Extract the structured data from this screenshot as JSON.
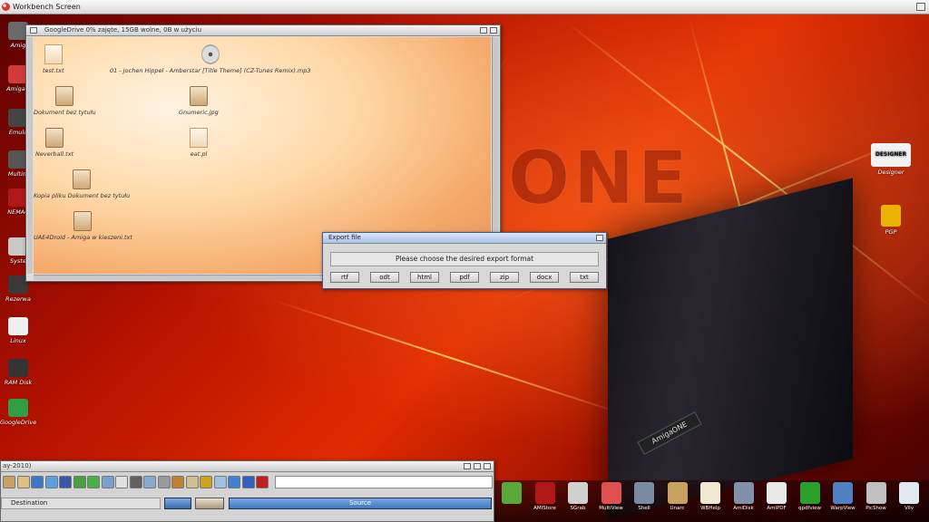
{
  "screen": {
    "title": "Workbench Screen"
  },
  "wallpaper": {
    "logo_text": "ONE",
    "tower_badge": "AmigaONE"
  },
  "desktop_left": [
    {
      "label": "Amig",
      "color": "#6a6a6a"
    },
    {
      "label": "AmigaO",
      "color": "#d33b3b"
    },
    {
      "label": "Emula",
      "color": "#444444"
    },
    {
      "label": "Multim",
      "color": "#555555"
    },
    {
      "label": "NEMAC",
      "color": "#b01818"
    },
    {
      "label": "Syste",
      "color": "#c8c8c8"
    },
    {
      "label": "Rezerwa",
      "color": "#3a3a3a"
    },
    {
      "label": "Linux",
      "color": "#f0f0f0"
    },
    {
      "label": "RAM Disk",
      "color": "#333333"
    },
    {
      "label": "GoogleDrive",
      "color": "#2f9e44"
    }
  ],
  "desktop_right": [
    {
      "label": "Designer",
      "color": "#f2f2f2"
    },
    {
      "label": "PGP",
      "color": "#e8b400"
    }
  ],
  "designer_logo": "DESIGNER",
  "gdrive_window": {
    "title": "GoogleDrive  0% zajęte, 15GB wolne, 0B w użyciu",
    "files": [
      {
        "label": "test.txt",
        "kind": "doc"
      },
      {
        "label": "01 - Jochen Hippel - Amberstar [Title Theme] (CZ-Tunes Remix).mp3",
        "kind": "cd"
      },
      {
        "label": "Dokument bez tytułu",
        "kind": "pic"
      },
      {
        "label": "Gnumeric.jpg",
        "kind": "pic"
      },
      {
        "label": "Neverball.txt",
        "kind": "pic"
      },
      {
        "label": "eat.pl",
        "kind": "doc"
      },
      {
        "label": "Kopia pliku Dokument bez tytułu",
        "kind": "pic"
      },
      {
        "label": "UAE4Droid - Amiga w kieszeni.txt",
        "kind": "pic"
      }
    ]
  },
  "export_dialog": {
    "title": "Export file",
    "prompt": "Please choose the desired export format",
    "formats": [
      "rtf",
      "odt",
      "html",
      "pdf",
      "zip",
      "docx",
      "txt"
    ]
  },
  "lower_window": {
    "title": "ay-2010)",
    "destination_label": "Destination",
    "source_label": "Source",
    "tool_colors": [
      "#c8a060",
      "#e0c080",
      "#3a78c8",
      "#5aa0e0",
      "#3a58a8",
      "#4aa040",
      "#4ab040",
      "#7aa0d0",
      "#e0e0e0",
      "#606060",
      "#88aacc",
      "#999999",
      "#c08030",
      "#d0c090",
      "#d0a020",
      "#a0c0e0",
      "#4080d0",
      "#3060c0",
      "#c02020"
    ]
  },
  "dock": [
    {
      "label": "",
      "color": "#5aa83a"
    },
    {
      "label": "AMIStore",
      "color": "#b01818"
    },
    {
      "label": "SGrab",
      "color": "#d0d0d0"
    },
    {
      "label": "MultiView",
      "color": "#e05050"
    },
    {
      "label": "Shell",
      "color": "#7a8aa0"
    },
    {
      "label": "Unarc",
      "color": "#c8a060"
    },
    {
      "label": "WBHelp",
      "color": "#f0e8d0"
    },
    {
      "label": "AmiDisk",
      "color": "#8090a8"
    },
    {
      "label": "AmiPDF",
      "color": "#e8e8e8"
    },
    {
      "label": "qpdfview",
      "color": "#2aa02a"
    },
    {
      "label": "WarpView",
      "color": "#5080c0"
    },
    {
      "label": "PicShow",
      "color": "#c0c0c0"
    },
    {
      "label": "Vilv",
      "color": "#e0e8f0"
    }
  ]
}
